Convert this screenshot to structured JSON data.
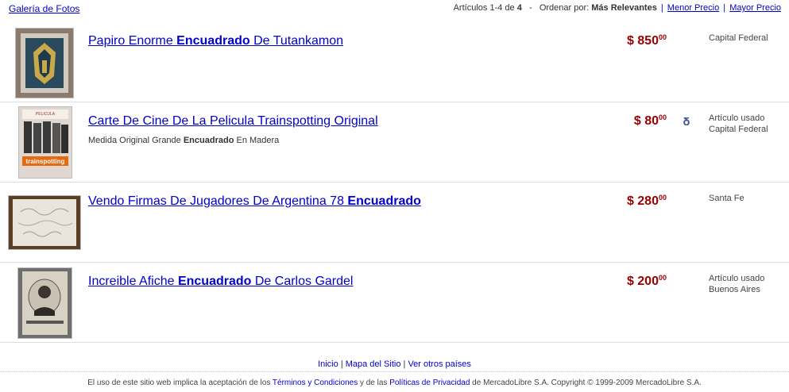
{
  "topbar": {
    "gallery_link": "Galería de Fotos",
    "results_prefix": "Artículos 1-4 de ",
    "results_total": "4",
    "dash": "-",
    "order_label": "Ordenar por:",
    "order_current": "Más Relevantes",
    "order_low": "Menor Precio",
    "order_high": "Mayor Precio",
    "separator": "|"
  },
  "items": [
    {
      "title_pre": "Papiro Enorme ",
      "title_bold": "Encuadrado",
      "title_post": " De Tutankamon",
      "desc_pre": "",
      "desc_bold": "",
      "desc_post": "",
      "price": "$ 850",
      "cents": "00",
      "condition": "",
      "location": "Capital Federal"
    },
    {
      "title_pre": "Carte De Cine De La Pelicula Trainspotting Original",
      "title_bold": "",
      "title_post": "",
      "desc_pre": "Medida Original Grande ",
      "desc_bold": "Encuadrado",
      "desc_post": " En Madera",
      "price": "$ 80",
      "cents": "00",
      "condition": "Artículo usado",
      "location": "Capital Federal"
    },
    {
      "title_pre": "Vendo Firmas De Jugadores De Argentina 78 ",
      "title_bold": "Encuadrado",
      "title_post": "",
      "desc_pre": "",
      "desc_bold": "",
      "desc_post": "",
      "price": "$ 280",
      "cents": "00",
      "condition": "",
      "location": "Santa Fe"
    },
    {
      "title_pre": "Increible Afiche ",
      "title_bold": "Encuadrado",
      "title_post": " De Carlos Gardel",
      "desc_pre": "",
      "desc_bold": "",
      "desc_post": "",
      "price": "$ 200",
      "cents": "00",
      "condition": "Artículo usado",
      "location": "Buenos Aires"
    }
  ],
  "footer": {
    "home": "Inicio",
    "sitemap": "Mapa del Sitio",
    "countries": "Ver otros países",
    "sep": "|",
    "legal_pre": "El uso de este sitio web implica la aceptación de los ",
    "terms": "Términos y Condiciones",
    "legal_mid": " y de las ",
    "privacy": "Políticas de Privacidad",
    "legal_post": " de MercadoLibre S.A. Copyright © 1999-2009 MercadoLibre S.A."
  },
  "colors": {
    "link": "#0000cc",
    "price": "#990000",
    "medal": "#445599"
  }
}
